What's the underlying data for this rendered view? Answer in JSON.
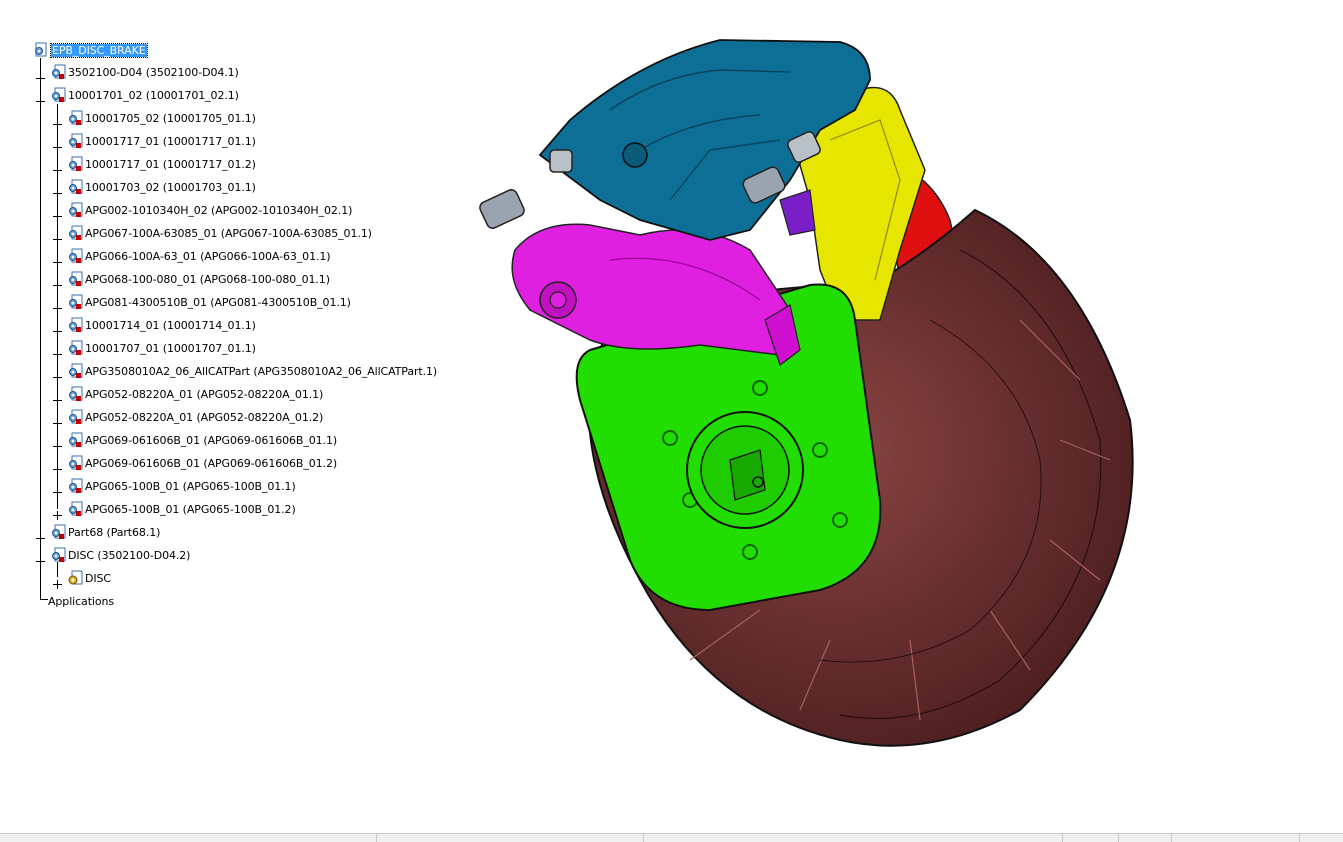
{
  "tree": {
    "root": "EPB_DISC_BRAKE",
    "items": [
      {
        "label": "3502100-D04 (3502100-D04.1)",
        "icon": "product-icon"
      },
      {
        "label": "10001701_02 (10001701_02.1)",
        "icon": "product-icon"
      },
      {
        "label": "10001705_02 (10001705_01.1)",
        "icon": "product-icon"
      },
      {
        "label": "10001717_01 (10001717_01.1)",
        "icon": "product-icon"
      },
      {
        "label": "10001717_01 (10001717_01.2)",
        "icon": "product-icon"
      },
      {
        "label": "10001703_02 (10001703_01.1)",
        "icon": "product-icon"
      },
      {
        "label": "APG002-1010340H_02 (APG002-1010340H_02.1)",
        "icon": "product-icon"
      },
      {
        "label": "APG067-100A-63085_01 (APG067-100A-63085_01.1)",
        "icon": "product-icon"
      },
      {
        "label": "APG066-100A-63_01 (APG066-100A-63_01.1)",
        "icon": "product-icon"
      },
      {
        "label": "APG068-100-080_01 (APG068-100-080_01.1)",
        "icon": "product-icon"
      },
      {
        "label": "APG081-4300510B_01 (APG081-4300510B_01.1)",
        "icon": "product-icon"
      },
      {
        "label": "10001714_01 (10001714_01.1)",
        "icon": "product-icon"
      },
      {
        "label": "10001707_01 (10001707_01.1)",
        "icon": "product-icon"
      },
      {
        "label": "APG3508010A2_06_AllCATPart (APG3508010A2_06_AllCATPart.1)",
        "icon": "product-icon"
      },
      {
        "label": "APG052-08220A_01 (APG052-08220A_01.1)",
        "icon": "product-icon"
      },
      {
        "label": "APG052-08220A_01 (APG052-08220A_01.2)",
        "icon": "product-icon"
      },
      {
        "label": "APG069-061606B_01 (APG069-061606B_01.1)",
        "icon": "product-icon"
      },
      {
        "label": "APG069-061606B_01 (APG069-061606B_01.2)",
        "icon": "product-icon"
      },
      {
        "label": "APG065-100B_01 (APG065-100B_01.1)",
        "icon": "product-icon"
      },
      {
        "label": "APG065-100B_01 (APG065-100B_01.2)",
        "icon": "product-icon"
      },
      {
        "label": "Part68 (Part68.1)",
        "icon": "product-icon"
      },
      {
        "label": "DISC (3502100-D04.2)",
        "icon": "product-icon"
      },
      {
        "label": "DISC",
        "icon": "part-icon"
      },
      {
        "label": "Applications",
        "icon": ""
      }
    ]
  },
  "colors": {
    "selection": "#3399ff",
    "disc": "#6b2e2e",
    "caliper": "#0e6f96",
    "bracket_yellow": "#e6e600",
    "actuator_magenta": "#e020e0",
    "anchor_green": "#22dd00",
    "pad_red": "#e01010"
  }
}
